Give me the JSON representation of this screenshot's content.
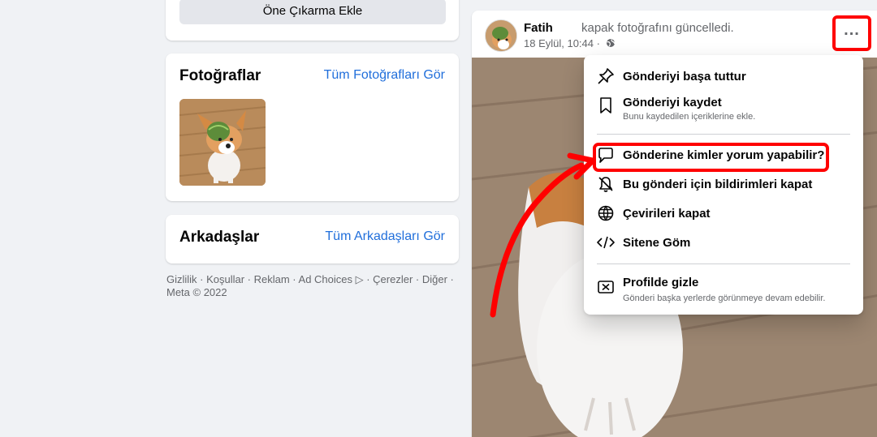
{
  "sidebar": {
    "feature_button": "Öne Çıkarma Ekle",
    "photos": {
      "title": "Fotoğraflar",
      "see_all": "Tüm Fotoğrafları Gör"
    },
    "friends": {
      "title": "Arkadaşlar",
      "see_all": "Tüm Arkadaşları Gör"
    },
    "footer": "Gizlilik · Koşullar · Reklam · Ad Choices ▷ · Çerezler · Diğer · Meta © 2022"
  },
  "post": {
    "author": "Fatih",
    "action": "kapak fotoğrafını güncelledi.",
    "date": "18 Eylül, 10:44 ·",
    "privacy_icon": "globe-icon",
    "more_icon": "more-options-icon"
  },
  "menu": {
    "items": [
      {
        "label": "Gönderiyi başa tuttur",
        "icon": "pin-icon"
      },
      {
        "label": "Gönderiyi kaydet",
        "sub": "Bunu kaydedilen içeriklerine ekle.",
        "icon": "bookmark-icon"
      },
      {
        "label": "Gönderine kimler yorum yapabilir?",
        "icon": "comment-icon"
      },
      {
        "label": "Bu gönderi için bildirimleri kapat",
        "icon": "bell-off-icon"
      },
      {
        "label": "Çevirileri kapat",
        "icon": "globe-icon"
      },
      {
        "label": "Sitene Göm",
        "icon": "code-icon"
      },
      {
        "label": "Profilde gizle",
        "sub": "Gönderi başka yerlerde görünmeye devam edebilir.",
        "icon": "close-box-icon"
      }
    ]
  },
  "annotation_color": "#ff0000",
  "link_color": "#216fdb"
}
